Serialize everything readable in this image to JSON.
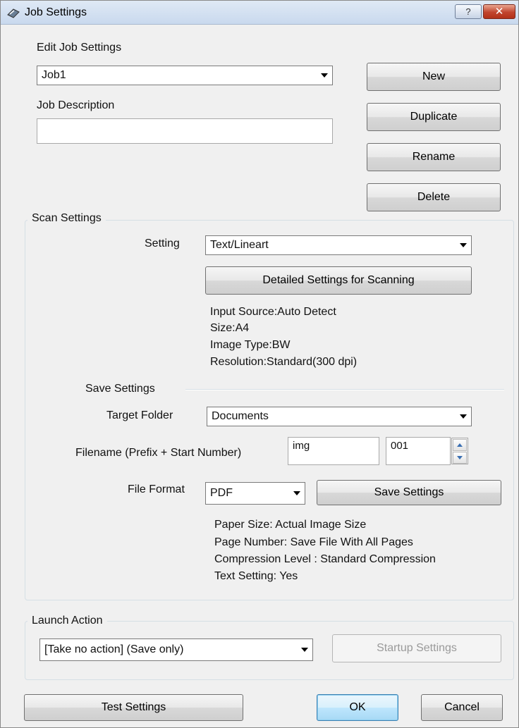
{
  "window": {
    "title": "Job Settings",
    "help_label": "?",
    "close_label": "✕"
  },
  "edit_job": {
    "section_label": "Edit Job Settings",
    "selected_job": "Job1",
    "description_label": "Job Description",
    "description_value": "",
    "buttons": {
      "new": "New",
      "duplicate": "Duplicate",
      "rename": "Rename",
      "delete": "Delete"
    }
  },
  "scan_settings": {
    "group_label": "Scan Settings",
    "setting_label": "Setting",
    "setting_value": "Text/Lineart",
    "detailed_button": "Detailed Settings for Scanning",
    "info": [
      "Input Source:Auto Detect",
      "Size:A4",
      "Image Type:BW",
      "Resolution:Standard(300 dpi)"
    ]
  },
  "save_settings": {
    "section_label": "Save Settings",
    "target_folder_label": "Target Folder",
    "target_folder_value": "Documents",
    "filename_label": "Filename (Prefix + Start Number)",
    "prefix_value": "img",
    "start_number_value": "001",
    "file_format_label": "File Format",
    "file_format_value": "PDF",
    "save_settings_button": "Save Settings",
    "info": [
      "Paper Size: Actual Image Size",
      "Page Number: Save File With All Pages",
      "Compression Level : Standard Compression",
      "Text Setting: Yes"
    ]
  },
  "launch_action": {
    "group_label": "Launch Action",
    "action_value": "[Take no action] (Save only)",
    "startup_button": "Startup Settings"
  },
  "footer": {
    "test_button": "Test Settings",
    "ok_button": "OK",
    "cancel_button": "Cancel"
  }
}
